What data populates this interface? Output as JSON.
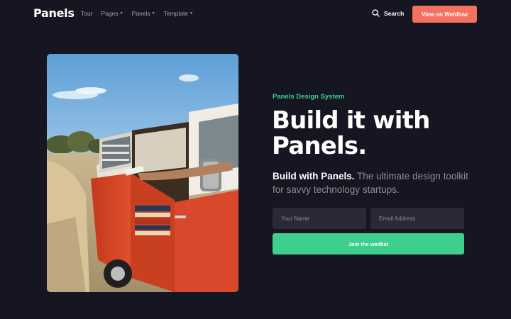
{
  "nav": {
    "brand": "Panels",
    "links": [
      {
        "label": "Tour",
        "dropdown": false
      },
      {
        "label": "Pages",
        "dropdown": true
      },
      {
        "label": "Panels",
        "dropdown": true
      },
      {
        "label": "Template",
        "dropdown": true
      }
    ],
    "search_label": "Search",
    "cta_label": "View on Webflow"
  },
  "hero": {
    "eyebrow": "Panels Design System",
    "headline_line1": "Build it with",
    "headline_line2": "Panels.",
    "sub_strong": "Build with Panels.",
    "sub_rest": " The ultimate design toolkit for savvy technology startups.",
    "form": {
      "name_placeholder": "Your Name",
      "email_placeholder": "Email Address",
      "submit_label": "Join the waitlist"
    }
  },
  "colors": {
    "background": "#161622",
    "accent_green": "#3ecf8e",
    "accent_coral": "#f47161",
    "input_bg": "#2a2a36"
  },
  "icons": [
    "search-icon",
    "caret-down-icon"
  ]
}
